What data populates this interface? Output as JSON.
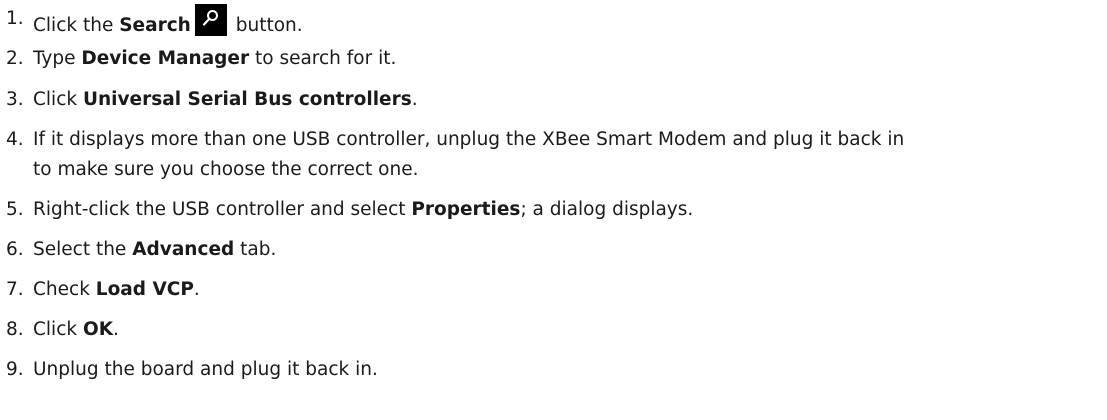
{
  "steps": [
    {
      "num": "1.",
      "pre": "Click the ",
      "bold": "Search",
      "post": " button."
    },
    {
      "num": "2.",
      "pre": "Type ",
      "bold": "Device Manager",
      "post": " to search for it."
    },
    {
      "num": "3.",
      "pre": "Click ",
      "bold": "Universal Serial Bus controllers",
      "post": "."
    },
    {
      "num": "4.",
      "line1": "If it displays more than one USB controller, unplug the XBee Smart Modem and plug it back in",
      "line2": "to make sure you choose the correct one."
    },
    {
      "num": "5.",
      "pre": "Right-click the USB controller and select ",
      "bold": "Properties",
      "post": "; a dialog displays."
    },
    {
      "num": "6.",
      "pre": "Select the ",
      "bold": "Advanced",
      "post": " tab."
    },
    {
      "num": "7.",
      "pre": "Check ",
      "bold": "Load VCP",
      "post": "."
    },
    {
      "num": "8.",
      "pre": "Click ",
      "bold": "OK",
      "post": "."
    },
    {
      "num": "9.",
      "text": "Unplug the board and plug it back in."
    }
  ],
  "icons": {
    "search": "search-icon"
  }
}
